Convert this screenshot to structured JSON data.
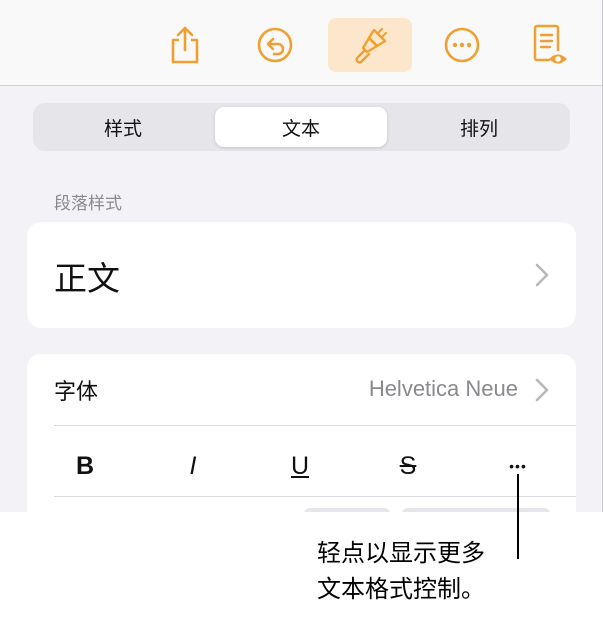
{
  "toolbar": {
    "buttons": [
      {
        "name": "share",
        "icon": "share-icon"
      },
      {
        "name": "undo",
        "icon": "undo-icon"
      },
      {
        "name": "format",
        "icon": "paintbrush-icon",
        "active": true
      },
      {
        "name": "more",
        "icon": "ellipsis-circle-icon"
      },
      {
        "name": "view",
        "icon": "document-eye-icon"
      }
    ],
    "accent_color": "#f0a030"
  },
  "tabs": [
    {
      "label": "样式",
      "selected": false
    },
    {
      "label": "文本",
      "selected": true
    },
    {
      "label": "排列",
      "selected": false
    }
  ],
  "paragraph_style": {
    "section_label": "段落样式",
    "value": "正文"
  },
  "font": {
    "label": "字体",
    "value": "Helvetica Neue"
  },
  "text_styles": {
    "bold": "B",
    "italic": "I",
    "underline": "U",
    "strikethrough": "S",
    "more": "•••"
  },
  "callout": {
    "line1": "轻点以显示更多",
    "line2": "文本格式控制。"
  }
}
